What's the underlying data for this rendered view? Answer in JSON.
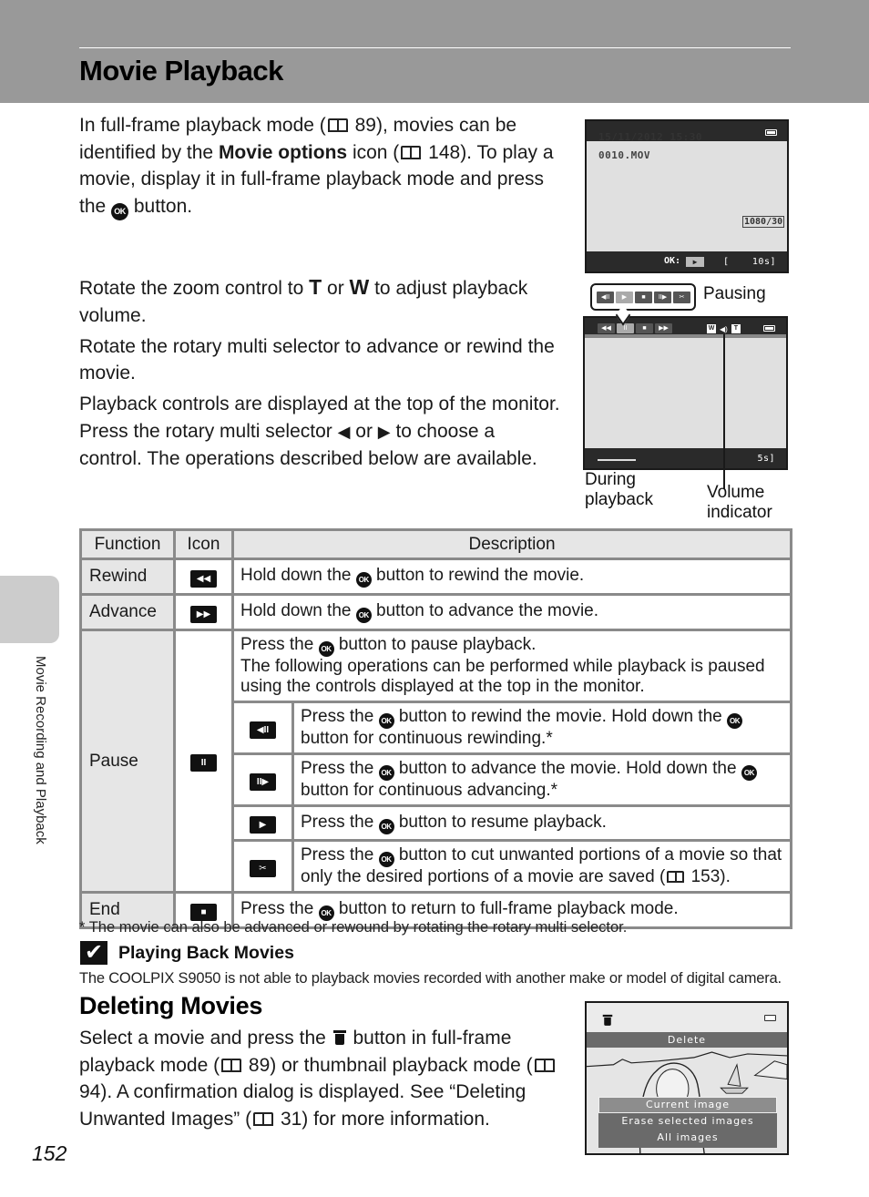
{
  "header": {
    "title": "Movie Playback"
  },
  "side_tab": {
    "label": "Movie Recording and Playback"
  },
  "intro": {
    "part1": "In full-frame playback mode (",
    "ref1": "89",
    "part2": "), movies can be identified by the ",
    "bold": "Movie options",
    "part3": " icon (",
    "ref2": "148",
    "part4": "). To play a movie, display it in full-frame playback mode and press the ",
    "part5": " button."
  },
  "ok_label": "OK",
  "instructions": {
    "p1_a": "Rotate the zoom control to ",
    "p1_t": "T",
    "p1_or": " or ",
    "p1_w": "W",
    "p1_b": " to adjust playback volume.",
    "p2": "Rotate the rotary multi selector to advance or rewind the movie.",
    "p3_a": "Playback controls are displayed at the top of the monitor. Press the rotary multi selector ",
    "p3_left": "◀",
    "p3_or": " or ",
    "p3_right": "▶",
    "p3_b": " to choose a control. The operations described below are available."
  },
  "screen1": {
    "datetime": "15/11/2012 15:30",
    "filename": "0010.MOV",
    "movie_option": "1080/30",
    "ok_prompt": "OK:",
    "play_glyph": "▶",
    "bracket_left": "[",
    "duration": "10s]"
  },
  "screen2": {
    "pausing_label": "Pausing",
    "during_label_1": "During",
    "during_label_2": "playback",
    "volume_label_1": "Volume",
    "volume_label_2": "indicator",
    "remaining": "5s]",
    "pause_controls": [
      "◀II",
      "▶",
      "■",
      "II▶",
      "✂"
    ],
    "play_controls": [
      "◀◀",
      "II",
      "■",
      "▶▶"
    ],
    "vol_w": "W",
    "vol_spk": "◀)",
    "vol_t": "T"
  },
  "table": {
    "headers": {
      "function": "Function",
      "icon": "Icon",
      "description": "Description"
    },
    "rows": {
      "rewind": {
        "function": "Rewind",
        "icon": "◀◀",
        "desc_a": "Hold down the ",
        "desc_b": " button to rewind the movie."
      },
      "advance": {
        "function": "Advance",
        "icon": "▶▶",
        "desc_a": "Hold down the ",
        "desc_b": " button to advance the movie."
      },
      "pause": {
        "function": "Pause",
        "icon": "II",
        "desc_a": "Press the ",
        "desc_b": " button to pause playback.",
        "desc_c": "The following operations can be performed while playback is paused using the controls displayed at the top in the monitor.",
        "sub": [
          {
            "icon": "◀II",
            "text_a": "Press the ",
            "text_b": " button to rewind the movie. Hold down the ",
            "text_c": " button for continuous rewinding.*"
          },
          {
            "icon": "II▶",
            "text_a": "Press the ",
            "text_b": " button to advance the movie. Hold down the ",
            "text_c": " button for continuous advancing.*"
          },
          {
            "icon": "▶",
            "text_a": "Press the ",
            "text_b": " button to resume playback."
          },
          {
            "icon": "✂",
            "text_a": "Press the ",
            "text_b": " button to cut unwanted portions of a movie so that only the desired portions of a movie are saved (",
            "ref": "153",
            "text_c": ")."
          }
        ]
      },
      "end": {
        "function": "End",
        "icon": "■",
        "desc_a": "Press the ",
        "desc_b": " button to return to full-frame playback mode."
      }
    }
  },
  "footnote": "*  The movie can also be advanced or rewound by rotating the rotary multi selector.",
  "note": {
    "icon": "✔",
    "title": "Playing Back Movies",
    "body": "The COOLPIX S9050 is not able to playback movies recorded with another make or model of digital camera."
  },
  "deleting": {
    "title": "Deleting Movies",
    "t1": "Select a movie and press the ",
    "t2": " button in full-frame playback mode (",
    "ref1": "89",
    "t3": ") or thumbnail playback mode (",
    "ref2": "94",
    "t4": "). A confirmation dialog is displayed. See “Deleting Unwanted Images” (",
    "ref3": "31",
    "t5": ") for more information."
  },
  "screen3": {
    "header": "Delete",
    "options": [
      "Current image",
      "Erase selected images",
      "All images"
    ],
    "selected": "Current image"
  },
  "page_number": "152"
}
